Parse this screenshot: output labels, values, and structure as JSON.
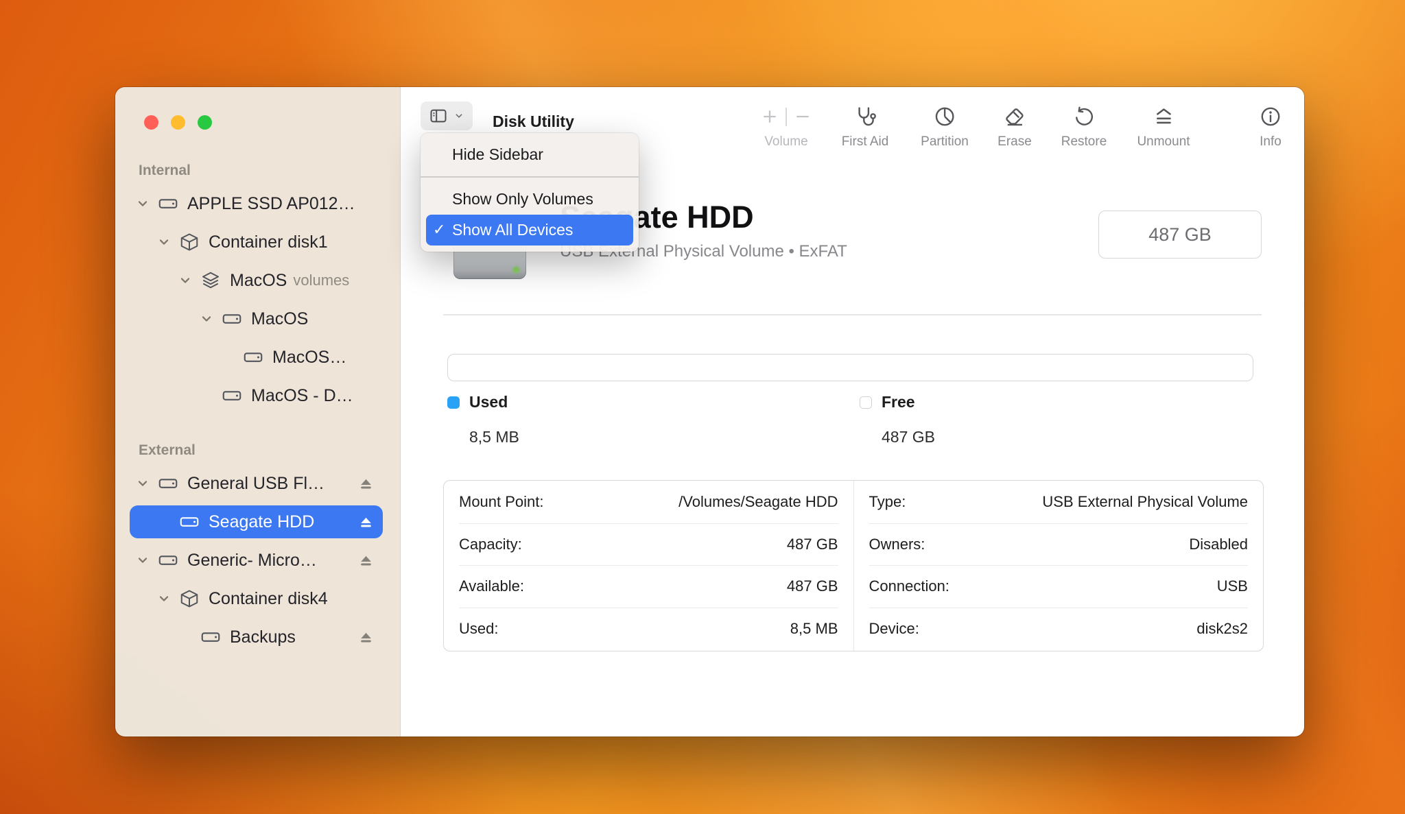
{
  "colors": {
    "accent": "#3b78f2",
    "used": "#2aa3f7",
    "close": "#ff5f57",
    "minimize": "#febc2e",
    "zoom": "#28c840"
  },
  "window": {
    "toolbar": {
      "title": "Disk Utility",
      "buttons": [
        {
          "id": "volume",
          "label": "Volume",
          "disabled": true
        },
        {
          "id": "first-aid",
          "label": "First Aid",
          "disabled": false
        },
        {
          "id": "partition",
          "label": "Partition",
          "disabled": false
        },
        {
          "id": "erase",
          "label": "Erase",
          "disabled": false
        },
        {
          "id": "restore",
          "label": "Restore",
          "disabled": false
        },
        {
          "id": "unmount",
          "label": "Unmount",
          "disabled": false
        },
        {
          "id": "info",
          "label": "Info",
          "disabled": false
        }
      ]
    },
    "sidebar": {
      "sections": [
        {
          "label": "Internal",
          "items": [
            {
              "label": "APPLE SSD AP012…",
              "indent": 0,
              "chevron": true,
              "icon": "disk-icon",
              "eject": false,
              "selected": false
            },
            {
              "label": "Container disk1",
              "indent": 1,
              "chevron": true,
              "icon": "container-icon",
              "eject": false,
              "selected": false
            },
            {
              "label": "MacOS",
              "suffix": "volumes",
              "indent": 2,
              "chevron": true,
              "icon": "volumes-icon",
              "eject": false,
              "selected": false
            },
            {
              "label": "MacOS",
              "indent": 3,
              "chevron": true,
              "icon": "disk-icon",
              "eject": false,
              "selected": false
            },
            {
              "label": "MacOS…",
              "indent": 4,
              "chevron": false,
              "icon": "disk-icon",
              "eject": false,
              "selected": false
            },
            {
              "label": "MacOS - D…",
              "indent": 3,
              "chevron": false,
              "icon": "disk-icon",
              "eject": false,
              "selected": false
            }
          ]
        },
        {
          "label": "External",
          "items": [
            {
              "label": "General USB Fl…",
              "indent": 0,
              "chevron": true,
              "icon": "disk-icon",
              "eject": true,
              "selected": false
            },
            {
              "label": "Seagate HDD",
              "indent": 1,
              "chevron": false,
              "icon": "disk-icon",
              "eject": true,
              "selected": true
            },
            {
              "label": "Generic- Micro…",
              "indent": 0,
              "chevron": true,
              "icon": "disk-icon",
              "eject": true,
              "selected": false
            },
            {
              "label": "Container disk4",
              "indent": 1,
              "chevron": true,
              "icon": "container-icon",
              "eject": false,
              "selected": false
            },
            {
              "label": "Backups",
              "indent": 2,
              "chevron": false,
              "icon": "disk-icon",
              "eject": true,
              "selected": false
            }
          ]
        }
      ]
    },
    "menu": {
      "checkmark": "✓",
      "items": [
        {
          "label": "Hide Sidebar",
          "checked": false,
          "highlighted": false,
          "separator_after": true
        },
        {
          "label": "Show Only Volumes",
          "checked": false,
          "highlighted": false,
          "separator_after": false
        },
        {
          "label": "Show All Devices",
          "checked": true,
          "highlighted": true,
          "separator_after": false
        }
      ]
    },
    "content": {
      "device_title": "Seagate HDD",
      "device_subtitle": "USB External Physical Volume • ExFAT",
      "size_badge": "487 GB",
      "legend": [
        {
          "label": "Used",
          "value": "8,5 MB",
          "filled": true
        },
        {
          "label": "Free",
          "value": "487 GB",
          "filled": false
        }
      ],
      "details_left": [
        {
          "label": "Mount Point:",
          "value": "/Volumes/Seagate HDD"
        },
        {
          "label": "Capacity:",
          "value": "487 GB"
        },
        {
          "label": "Available:",
          "value": "487 GB"
        },
        {
          "label": "Used:",
          "value": "8,5 MB"
        }
      ],
      "details_right": [
        {
          "label": "Type:",
          "value": "USB External Physical Volume"
        },
        {
          "label": "Owners:",
          "value": "Disabled"
        },
        {
          "label": "Connection:",
          "value": "USB"
        },
        {
          "label": "Device:",
          "value": "disk2s2"
        }
      ]
    }
  }
}
